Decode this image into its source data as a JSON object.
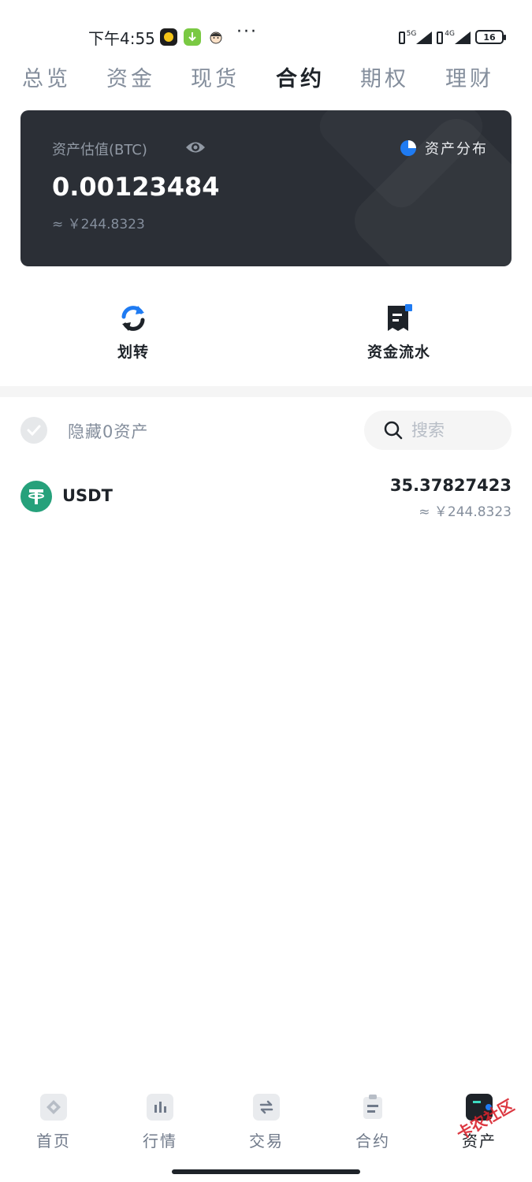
{
  "status_bar": {
    "time": "下午4:55",
    "dots": "···",
    "signal1_label": "5G",
    "signal2_label": "4G",
    "battery": "16"
  },
  "tabs": [
    {
      "label": "总览",
      "active": false
    },
    {
      "label": "资金",
      "active": false
    },
    {
      "label": "现货",
      "active": false
    },
    {
      "label": "合约",
      "active": true
    },
    {
      "label": "期权",
      "active": false
    },
    {
      "label": "理财",
      "active": false
    }
  ],
  "asset_card": {
    "label": "资产估值(BTC)",
    "distribution_label": "资产分布",
    "value": "0.00123484",
    "fiat": "≈ ￥244.8323"
  },
  "actions": {
    "transfer_label": "划转",
    "history_label": "资金流水"
  },
  "filter": {
    "hide_label": "隐藏0资产",
    "search_placeholder": "搜索"
  },
  "assets": [
    {
      "symbol": "USDT",
      "amount": "35.37827423",
      "fiat": "≈ ￥244.8323"
    }
  ],
  "bottom_nav": [
    {
      "label": "首页",
      "icon": "home-icon",
      "active": false
    },
    {
      "label": "行情",
      "icon": "markets-icon",
      "active": false
    },
    {
      "label": "交易",
      "icon": "trade-icon",
      "active": false
    },
    {
      "label": "合约",
      "icon": "futures-icon",
      "active": false
    },
    {
      "label": "资产",
      "icon": "wallet-icon",
      "active": true
    }
  ],
  "watermark": "卡农社区",
  "colors": {
    "accent_blue": "#1f7bf2",
    "usdt_green": "#26a17b",
    "card_bg": "#2b2f36",
    "text_primary": "#1e2329",
    "text_secondary": "#848e9c"
  }
}
